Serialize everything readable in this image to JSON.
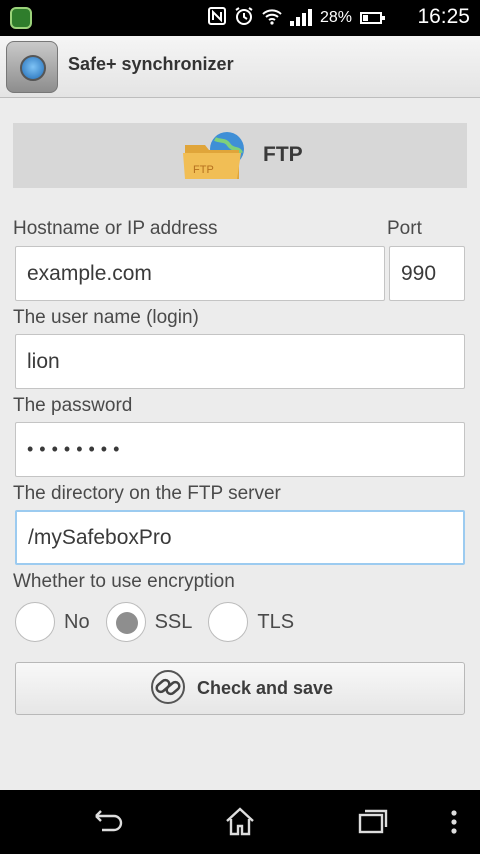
{
  "status_bar": {
    "battery_percent_label": "28%",
    "battery_level": 0.28,
    "time": "16:25",
    "icons": [
      "app-notification-icon",
      "nfc-icon",
      "alarm-icon",
      "wifi-icon",
      "signal-icon",
      "battery-icon"
    ]
  },
  "action_bar": {
    "title": "Safe+ synchronizer",
    "icon": "safe-app-icon"
  },
  "section": {
    "icon_label": "FTP",
    "title": "FTP"
  },
  "form": {
    "hostname_label": "Hostname or IP address",
    "hostname_value": "example.com",
    "port_label": "Port",
    "port_value": "990",
    "username_label": "The user name (login)",
    "username_value": "lion",
    "password_label": "The password",
    "password_mask": "••••••••",
    "directory_label": "The directory on the FTP server",
    "directory_value": "/mySafeboxPro",
    "encryption_label": "Whether to use encryption",
    "encryption_options": [
      "No",
      "SSL",
      "TLS"
    ],
    "encryption_selected": "SSL"
  },
  "actions": {
    "check_and_save_label": "Check and save"
  },
  "nav_bar": {
    "icons": [
      "back-icon",
      "home-icon",
      "recent-apps-icon",
      "overflow-menu-icon"
    ]
  },
  "colors": {
    "background": "#ececec",
    "status_bar": "#000000",
    "section_header": "#d7d7d7",
    "focused_border": "#9ccbf0"
  }
}
